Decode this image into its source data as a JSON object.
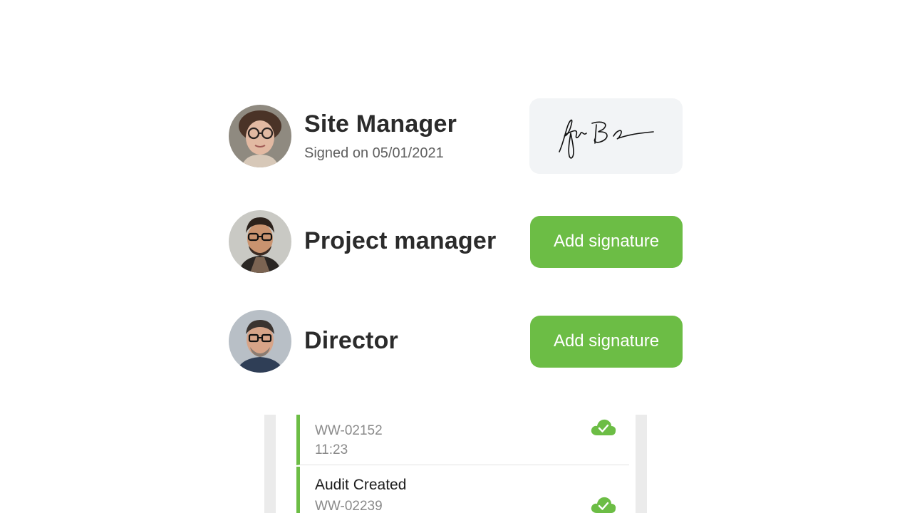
{
  "signers": [
    {
      "role": "Site Manager",
      "signed_text": "Signed on 05/01/2021",
      "signed": true
    },
    {
      "role": "Project manager",
      "button_label": "Add signature",
      "signed": false
    },
    {
      "role": "Director",
      "button_label": "Add signature",
      "signed": false
    }
  ],
  "feed": {
    "items": [
      {
        "title": "",
        "code": "WW-02152",
        "time": "11:23",
        "status_icon": "cloud-check-icon"
      },
      {
        "title": "Audit Created",
        "code": "WW-02239",
        "status_icon": "cloud-check-icon"
      }
    ]
  },
  "colors": {
    "accent": "#6cbd45",
    "signature_box": "#f2f4f6",
    "text_primary": "#2b2b2b",
    "text_secondary": "#5f5f5f",
    "feed_gutter": "#ebebeb"
  }
}
